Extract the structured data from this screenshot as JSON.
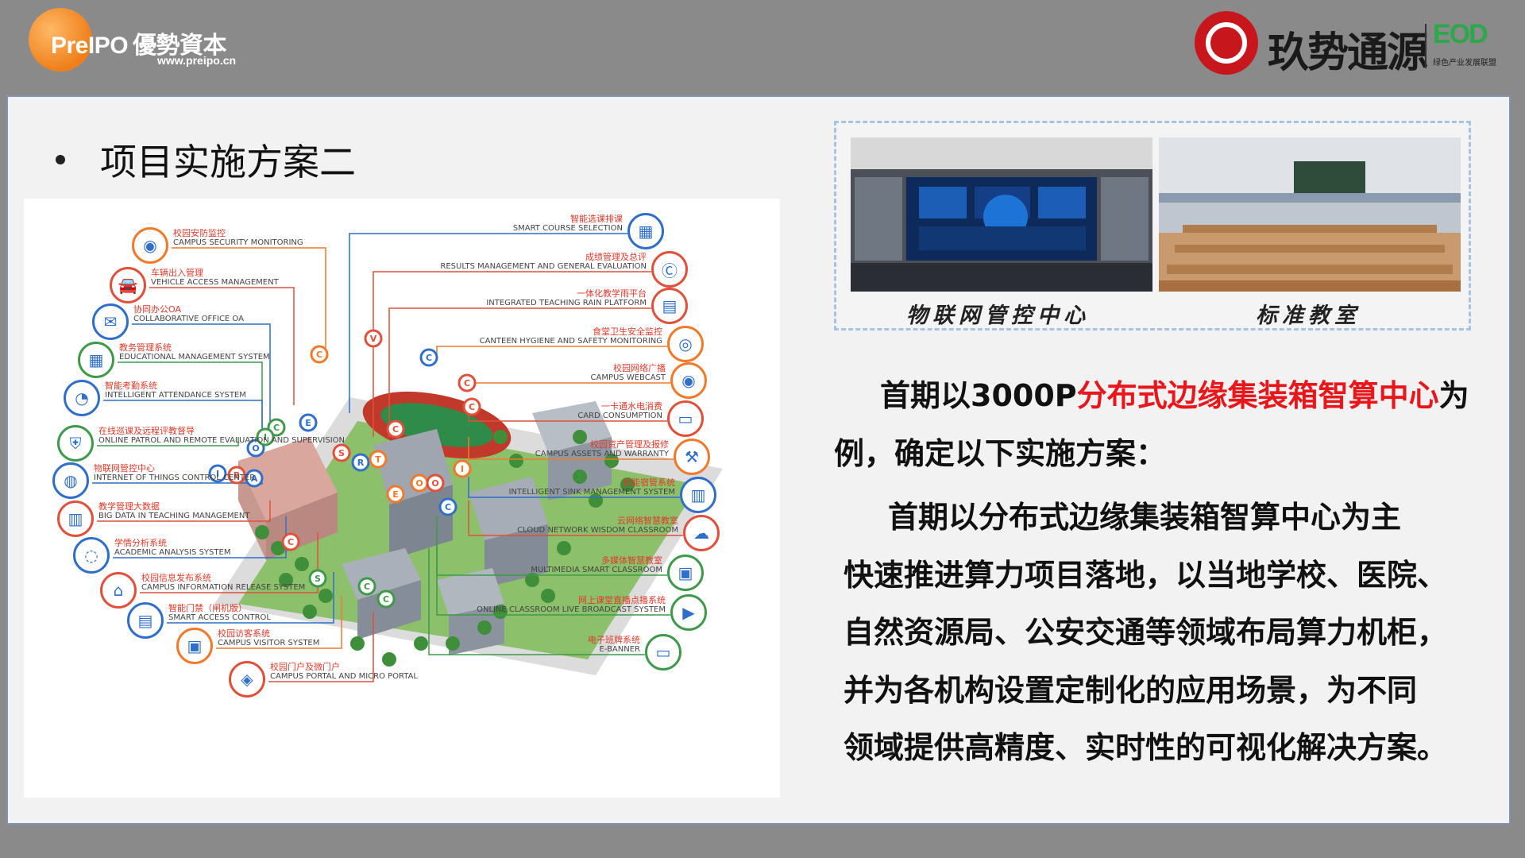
{
  "header": {
    "left_logo_text": "PreIPO",
    "left_logo_cn": "優勢資本",
    "left_logo_url": "www.preipo.cn",
    "right_logo_text": "玖势通源",
    "right_logo_mark": "EOD",
    "right_logo_sub": "绿色产业发展联盟"
  },
  "slide": {
    "title": "项目实施方案二"
  },
  "campus": {
    "systems": [
      {
        "cn": "校园安防监控",
        "en": "CAMPUS SECURITY MONITORING"
      },
      {
        "cn": "车辆出入管理",
        "en": "VEHICLE ACCESS MANAGEMENT"
      },
      {
        "cn": "协同办公OA",
        "en": "COLLABORATIVE OFFICE OA"
      },
      {
        "cn": "教务管理系统",
        "en": "EDUCATIONAL MANAGEMENT SYSTEM"
      },
      {
        "cn": "智能考勤系统",
        "en": "INTELLIGENT ATTENDANCE SYSTEM"
      },
      {
        "cn": "在线巡课及远程评教督导",
        "en": "ONLINE PATROL AND REMOTE EVALUATION AND SUPERVISION"
      },
      {
        "cn": "物联网管控中心",
        "en": "INTERNET OF THINGS CONTROL CENTER"
      },
      {
        "cn": "教学管理大数据",
        "en": "BIG DATA IN TEACHING MANAGEMENT"
      },
      {
        "cn": "学情分析系统",
        "en": "ACADEMIC ANALYSIS SYSTEM"
      },
      {
        "cn": "校园信息发布系统",
        "en": "CAMPUS INFORMATION RELEASE SYSTEM"
      },
      {
        "cn": "智能门禁（闸机版）",
        "en": "SMART ACCESS CONTROL"
      },
      {
        "cn": "校园访客系统",
        "en": "CAMPUS VISITOR SYSTEM"
      },
      {
        "cn": "校园门户及微门户",
        "en": "CAMPUS PORTAL AND MICRO PORTAL"
      },
      {
        "cn": "智能选课排课",
        "en": "SMART COURSE SELECTION"
      },
      {
        "cn": "成绩管理及总评",
        "en": "RESULTS MANAGEMENT AND GENERAL EVALUATION"
      },
      {
        "cn": "一体化教学雨平台",
        "en": "INTEGRATED TEACHING RAIN PLATFORM"
      },
      {
        "cn": "食堂卫生安全监控",
        "en": "CANTEEN HYGIENE AND SAFETY MONITORING"
      },
      {
        "cn": "校园网络广播",
        "en": "CAMPUS WEBCAST"
      },
      {
        "cn": "一卡通水电消费",
        "en": "CARD CONSUMPTION"
      },
      {
        "cn": "校园资产管理及报修",
        "en": "CAMPUS ASSETS AND WARRANTY"
      },
      {
        "cn": "智能宿管系统",
        "en": "INTELLIGENT SINK MANAGEMENT SYSTEM"
      },
      {
        "cn": "云网络智慧教室",
        "en": "CLOUD NETWORK WISDOM CLASSROOM"
      },
      {
        "cn": "多媒体智慧教室",
        "en": "MULTIMEDIA SMART CLASSROOM"
      },
      {
        "cn": "网上课堂直播点播系统",
        "en": "ONLINE CLASSROOM LIVE BROADCAST SYSTEM"
      },
      {
        "cn": "电子班牌系统",
        "en": "E-BANNER"
      }
    ],
    "pins": [
      "C",
      "V",
      "E",
      "C",
      "O",
      "I",
      "I",
      "B",
      "A",
      "S",
      "R",
      "T",
      "C",
      "C",
      "C",
      "C",
      "I",
      "O",
      "O",
      "E",
      "C",
      "C",
      "S",
      "C",
      "C"
    ]
  },
  "photos": {
    "caption_1": "物联网管控中心",
    "caption_2": "标准教室"
  },
  "text": {
    "p1_a": "首期以3000P",
    "p1_red": "分布式边缘集装箱智算中心",
    "p1_b": "为",
    "p1_c": "例，确定以下实施方案：",
    "p2_l1": "首期以分布式边缘集装箱智算中心为主",
    "p2_l2": "快速推进算力项目落地，以当地学校、医院、",
    "p2_l3": "自然资源局、公安交通等领域布局算力机柜，",
    "p2_l4": "并为各机构设置定制化的应用场景，为不同",
    "p2_l5": "领域提供高精度、实时性的可视化解决方案。"
  },
  "colors": {
    "accent_red": "#e8171c",
    "logo_orange": "#ef7f1a",
    "logo_red": "#c8161d",
    "eod_green": "#2aa84a"
  }
}
